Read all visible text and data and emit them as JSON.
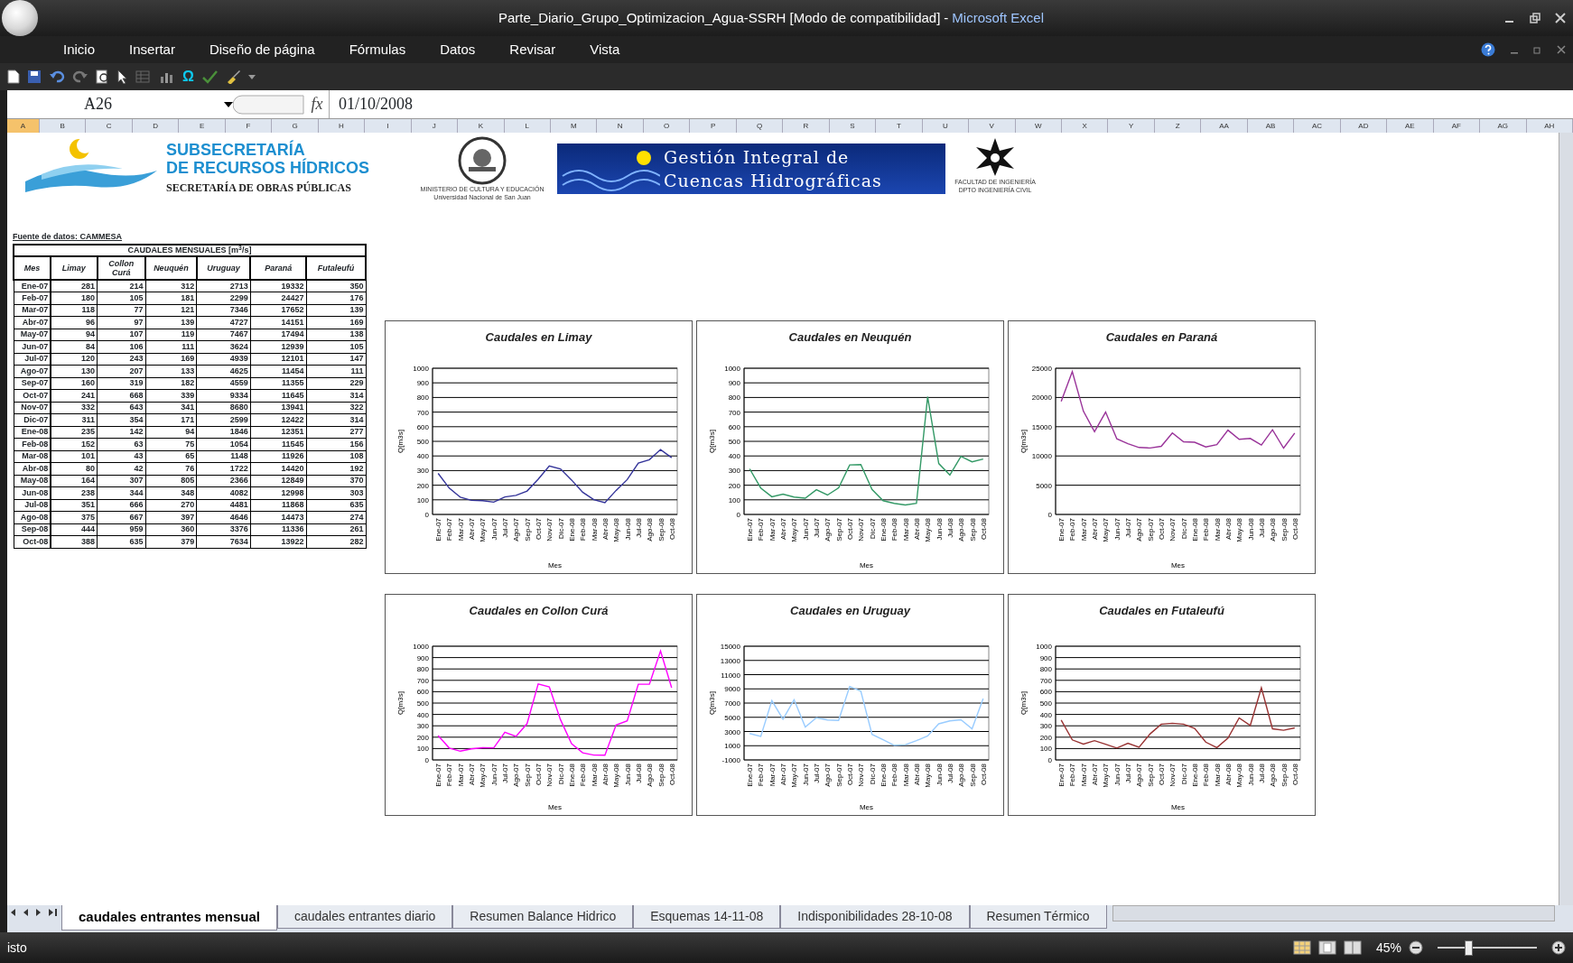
{
  "window": {
    "title": "Parte_Diario_Grupo_Optimizacion_Agua-SSRH  [Modo de compatibilidad]",
    "separator": "-",
    "app_name": "Microsoft Excel"
  },
  "ribbon_tabs": [
    {
      "label": "Inicio"
    },
    {
      "label": "Insertar"
    },
    {
      "label": "Diseño de página"
    },
    {
      "label": "Fórmulas"
    },
    {
      "label": "Datos"
    },
    {
      "label": "Revisar"
    },
    {
      "label": "Vista"
    }
  ],
  "quick_access_toolbar": {
    "symbol": "Ω"
  },
  "formula_bar": {
    "name_box": "A26",
    "function_label": "fx",
    "value": "01/10/2008"
  },
  "column_headers": [
    {
      "label": "A",
      "selected": true
    },
    {
      "label": "B",
      "selected": false
    },
    {
      "label": "C",
      "selected": false
    },
    {
      "label": "D",
      "selected": false
    },
    {
      "label": "E",
      "selected": false
    },
    {
      "label": "F",
      "selected": false
    },
    {
      "label": "G",
      "selected": false
    },
    {
      "label": "H",
      "selected": false
    },
    {
      "label": "I",
      "selected": false
    },
    {
      "label": "J",
      "selected": false
    },
    {
      "label": "K",
      "selected": false
    },
    {
      "label": "L",
      "selected": false
    },
    {
      "label": "M",
      "selected": false
    },
    {
      "label": "N",
      "selected": false
    },
    {
      "label": "O",
      "selected": false
    },
    {
      "label": "P",
      "selected": false
    },
    {
      "label": "Q",
      "selected": false
    },
    {
      "label": "R",
      "selected": false
    },
    {
      "label": "S",
      "selected": false
    },
    {
      "label": "T",
      "selected": false
    },
    {
      "label": "U",
      "selected": false
    },
    {
      "label": "V",
      "selected": false
    },
    {
      "label": "W",
      "selected": false
    },
    {
      "label": "X",
      "selected": false
    },
    {
      "label": "Y",
      "selected": false
    },
    {
      "label": "Z",
      "selected": false
    },
    {
      "label": "AA",
      "selected": false
    },
    {
      "label": "AB",
      "selected": false
    },
    {
      "label": "AC",
      "selected": false
    },
    {
      "label": "AD",
      "selected": false
    },
    {
      "label": "AE",
      "selected": false
    },
    {
      "label": "AF",
      "selected": false
    },
    {
      "label": "AG",
      "selected": false
    },
    {
      "label": "AH",
      "selected": false
    }
  ],
  "logos": {
    "subsecretaria": [
      "SUBSECRETARÍA",
      "DE RECURSOS HÍDRICOS",
      "SECRETARÍA DE OBRAS PÚBLICAS"
    ],
    "ministry": [
      "MINISTERIO DE CULTURA Y EDUCACIÓN",
      "Universidad Nacional de San Juan"
    ],
    "banner": [
      "Gestión Integral de",
      "Cuencas Hidrográficas"
    ],
    "faculty": [
      "FACULTAD DE INGENIERÍA",
      "DPTO INGENIERÍA CIVIL"
    ]
  },
  "table": {
    "source": "Fuente de datos: CAMMESA",
    "title": "CAUDALES MENSUALES [m$^{3}$/s]",
    "columns": [
      "Mes",
      "Limay",
      "Collon Curá",
      "Neuquén",
      "Uruguay",
      "Paraná",
      "Futaleufú"
    ],
    "rows": [
      [
        "Ene-07",
        "281",
        "214",
        "312",
        "2713",
        "19332",
        "350"
      ],
      [
        "Feb-07",
        "180",
        "105",
        "181",
        "2299",
        "24427",
        "176"
      ],
      [
        "Mar-07",
        "118",
        "77",
        "121",
        "7346",
        "17652",
        "139"
      ],
      [
        "Abr-07",
        "96",
        "97",
        "139",
        "4727",
        "14151",
        "169"
      ],
      [
        "May-07",
        "94",
        "107",
        "119",
        "7467",
        "17494",
        "138"
      ],
      [
        "Jun-07",
        "84",
        "106",
        "111",
        "3624",
        "12939",
        "105"
      ],
      [
        "Jul-07",
        "120",
        "243",
        "169",
        "4939",
        "12101",
        "147"
      ],
      [
        "Ago-07",
        "130",
        "207",
        "133",
        "4625",
        "11454",
        "111"
      ],
      [
        "Sep-07",
        "160",
        "319",
        "182",
        "4559",
        "11355",
        "229"
      ],
      [
        "Oct-07",
        "241",
        "668",
        "339",
        "9334",
        "11645",
        "314"
      ],
      [
        "Nov-07",
        "332",
        "643",
        "341",
        "8680",
        "13941",
        "322"
      ],
      [
        "Dic-07",
        "311",
        "354",
        "171",
        "2599",
        "12422",
        "314"
      ],
      [
        "Ene-08",
        "235",
        "142",
        "94",
        "1846",
        "12351",
        "277"
      ],
      [
        "Feb-08",
        "152",
        "63",
        "75",
        "1054",
        "11545",
        "156"
      ],
      [
        "Mar-08",
        "101",
        "43",
        "65",
        "1148",
        "11926",
        "108"
      ],
      [
        "Abr-08",
        "80",
        "42",
        "76",
        "1722",
        "14420",
        "192"
      ],
      [
        "May-08",
        "164",
        "307",
        "805",
        "2366",
        "12849",
        "370"
      ],
      [
        "Jun-08",
        "238",
        "344",
        "348",
        "4082",
        "12998",
        "303"
      ],
      [
        "Jul-08",
        "351",
        "666",
        "270",
        "4481",
        "11868",
        "635"
      ],
      [
        "Ago-08",
        "375",
        "667",
        "397",
        "4646",
        "14473",
        "274"
      ],
      [
        "Sep-08",
        "444",
        "959",
        "360",
        "3376",
        "11336",
        "261"
      ],
      [
        "Oct-08",
        "388",
        "635",
        "379",
        "7634",
        "13922",
        "282"
      ]
    ]
  },
  "charts": [
    {
      "chart_data": {
        "type": "line",
        "title": "Caudales en Limay",
        "xlabel": "Mes",
        "ylabel": "Q[m3s]",
        "categories": [
          "Ene-07",
          "Feb-07",
          "Mar-07",
          "Abr-07",
          "May-07",
          "Jun-07",
          "Jul-07",
          "Ago-07",
          "Sep-07",
          "Oct-07",
          "Nov-07",
          "Dic-07",
          "Ene-08",
          "Feb-08",
          "Mar-08",
          "Abr-08",
          "May-08",
          "Jun-08",
          "Jul-08",
          "Ago-08",
          "Sep-08",
          "Oct-08"
        ],
        "ylim": [
          0,
          1000
        ],
        "yticks": [
          0,
          100,
          200,
          300,
          400,
          500,
          600,
          700,
          800,
          900,
          1000
        ],
        "grid": true,
        "series": [
          {
            "color": "#333399",
            "values": [
              281,
              180,
              118,
              96,
              94,
              84,
              120,
              130,
              160,
              241,
              332,
              311,
              235,
              152,
              101,
              80,
              164,
              238,
              351,
              375,
              444,
              388
            ]
          }
        ]
      }
    },
    {
      "chart_data": {
        "type": "line",
        "title": "Caudales en Neuquén",
        "xlabel": "Mes",
        "ylabel": "Q[m3s]",
        "categories": [
          "Ene-07",
          "Feb-07",
          "Mar-07",
          "Abr-07",
          "May-07",
          "Jun-07",
          "Jul-07",
          "Ago-07",
          "Sep-07",
          "Oct-07",
          "Nov-07",
          "Dic-07",
          "Ene-08",
          "Feb-08",
          "Mar-08",
          "Abr-08",
          "May-08",
          "Jun-08",
          "Jul-08",
          "Ago-08",
          "Sep-08",
          "Oct-08"
        ],
        "ylim": [
          0,
          1000
        ],
        "yticks": [
          0,
          100,
          200,
          300,
          400,
          500,
          600,
          700,
          800,
          900,
          1000
        ],
        "grid": true,
        "series": [
          {
            "color": "#339966",
            "values": [
              312,
              181,
              121,
              139,
              119,
              111,
              169,
              133,
              182,
              339,
              341,
              171,
              94,
              75,
              65,
              76,
              805,
              348,
              270,
              397,
              360,
              379
            ]
          }
        ]
      }
    },
    {
      "chart_data": {
        "type": "line",
        "title": "Caudales en Paraná",
        "xlabel": "Mes",
        "ylabel": "Q[m3s]",
        "categories": [
          "Ene-07",
          "Feb-07",
          "Mar-07",
          "Abr-07",
          "May-07",
          "Jun-07",
          "Jul-07",
          "Ago-07",
          "Sep-07",
          "Oct-07",
          "Nov-07",
          "Dic-07",
          "Ene-08",
          "Feb-08",
          "Mar-08",
          "Abr-08",
          "May-08",
          "Jun-08",
          "Jul-08",
          "Ago-08",
          "Sep-08",
          "Oct-08"
        ],
        "ylim": [
          0,
          25000
        ],
        "yticks": [
          0,
          5000,
          10000,
          15000,
          20000,
          25000
        ],
        "grid": true,
        "series": [
          {
            "color": "#993399",
            "values": [
              19332,
              24427,
              17652,
              14151,
              17494,
              12939,
              12101,
              11454,
              11355,
              11645,
              13941,
              12422,
              12351,
              11545,
              11926,
              14420,
              12849,
              12998,
              11868,
              14473,
              11336,
              13922
            ]
          }
        ]
      }
    },
    {
      "chart_data": {
        "type": "line",
        "title": "Caudales en Collon Curá",
        "xlabel": "Mes",
        "ylabel": "Q[m3s]",
        "categories": [
          "Ene-07",
          "Feb-07",
          "Mar-07",
          "Abr-07",
          "May-07",
          "Jun-07",
          "Jul-07",
          "Ago-07",
          "Sep-07",
          "Oct-07",
          "Nov-07",
          "Dic-07",
          "Ene-08",
          "Feb-08",
          "Mar-08",
          "Abr-08",
          "May-08",
          "Jun-08",
          "Jul-08",
          "Ago-08",
          "Sep-08",
          "Oct-08"
        ],
        "ylim": [
          0,
          1000
        ],
        "yticks": [
          0,
          100,
          200,
          300,
          400,
          500,
          600,
          700,
          800,
          900,
          1000
        ],
        "grid": true,
        "series": [
          {
            "color": "#ff00ff",
            "values": [
              214,
              105,
              77,
              97,
              107,
              106,
              243,
              207,
              319,
              668,
              643,
              354,
              142,
              63,
              43,
              42,
              307,
              344,
              666,
              667,
              959,
              635
            ]
          }
        ]
      }
    },
    {
      "chart_data": {
        "type": "line",
        "title": "Caudales en Uruguay",
        "xlabel": "Mes",
        "ylabel": "Q[m3s]",
        "categories": [
          "Ene-07",
          "Feb-07",
          "Mar-07",
          "Abr-07",
          "May-07",
          "Jun-07",
          "Jul-07",
          "Ago-07",
          "Sep-07",
          "Oct-07",
          "Nov-07",
          "Dic-07",
          "Ene-08",
          "Feb-08",
          "Mar-08",
          "Abr-08",
          "May-08",
          "Jun-08",
          "Jul-08",
          "Ago-08",
          "Sep-08",
          "Oct-08"
        ],
        "ylim": [
          -1000,
          15000
        ],
        "yticks": [
          -1000,
          1000,
          3000,
          5000,
          7000,
          9000,
          11000,
          13000,
          15000
        ],
        "grid": true,
        "series": [
          {
            "color": "#99ccff",
            "values": [
              2713,
              2299,
              7346,
              4727,
              7467,
              3624,
              4939,
              4625,
              4559,
              9334,
              8680,
              2599,
              1846,
              1054,
              1148,
              1722,
              2366,
              4082,
              4481,
              4646,
              3376,
              7634
            ]
          }
        ]
      }
    },
    {
      "chart_data": {
        "type": "line",
        "title": "Caudales en Futaleufú",
        "xlabel": "Mes",
        "ylabel": "Q[m3s]",
        "categories": [
          "Ene-07",
          "Feb-07",
          "Mar-07",
          "Abr-07",
          "May-07",
          "Jun-07",
          "Jul-07",
          "Ago-07",
          "Sep-07",
          "Oct-07",
          "Nov-07",
          "Dic-07",
          "Ene-08",
          "Feb-08",
          "Mar-08",
          "Abr-08",
          "May-08",
          "Jun-08",
          "Jul-08",
          "Ago-08",
          "Sep-08",
          "Oct-08"
        ],
        "ylim": [
          0,
          1000
        ],
        "yticks": [
          0,
          100,
          200,
          300,
          400,
          500,
          600,
          700,
          800,
          900,
          1000
        ],
        "grid": true,
        "series": [
          {
            "color": "#993333",
            "values": [
              350,
              176,
              139,
              169,
              138,
              105,
              147,
              111,
              229,
              314,
              322,
              314,
              277,
              156,
              108,
              192,
              370,
              303,
              635,
              274,
              261,
              282
            ]
          }
        ]
      }
    }
  ],
  "sheet_tabs": [
    {
      "label": "caudales entrantes mensual",
      "selected": true
    },
    {
      "label": "caudales entrantes diario",
      "selected": false
    },
    {
      "label": "Resumen Balance Hidrico",
      "selected": false
    },
    {
      "label": "Esquemas 14-11-08",
      "selected": false
    },
    {
      "label": "Indisponibilidades 28-10-08",
      "selected": false
    },
    {
      "label": "Resumen Térmico",
      "selected": false
    }
  ],
  "status_bar": {
    "text": "isto",
    "zoom": "45%",
    "zoom_slider": {
      "level": 0.3
    }
  }
}
